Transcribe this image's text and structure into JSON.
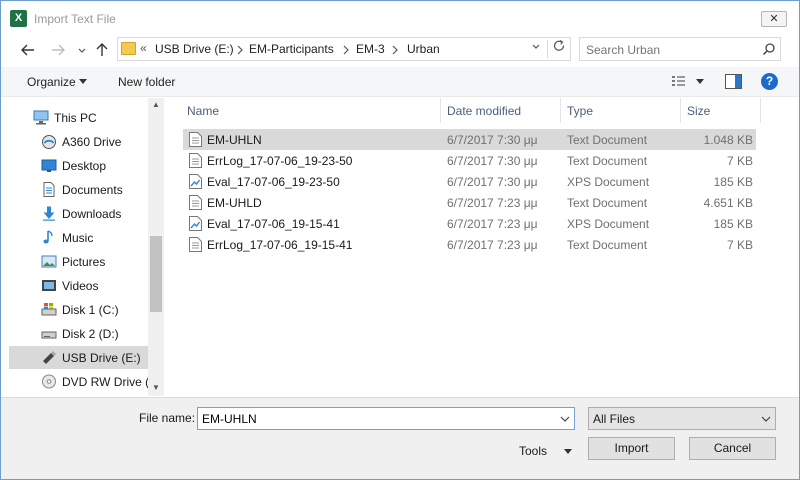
{
  "window": {
    "title": "Import Text File",
    "app_icon": "excel-icon",
    "app_icon_glyph": "X",
    "close_glyph": "✕"
  },
  "address_bar": {
    "overflow_glyph": "«",
    "path": [
      "USB Drive (E:)",
      "EM-Participants",
      "EM-3",
      "Urban"
    ]
  },
  "search": {
    "placeholder": "Search Urban"
  },
  "toolbar": {
    "organize_label": "Organize",
    "new_folder_label": "New folder",
    "help_glyph": "?"
  },
  "nav_pane": {
    "items": [
      {
        "label": "This PC",
        "icon": "computer-icon"
      },
      {
        "label": "A360 Drive",
        "icon": "cloud-drive-icon"
      },
      {
        "label": "Desktop",
        "icon": "desktop-icon"
      },
      {
        "label": "Documents",
        "icon": "documents-icon"
      },
      {
        "label": "Downloads",
        "icon": "downloads-icon"
      },
      {
        "label": "Music",
        "icon": "music-icon"
      },
      {
        "label": "Pictures",
        "icon": "pictures-icon"
      },
      {
        "label": "Videos",
        "icon": "videos-icon"
      },
      {
        "label": "Disk 1 (C:)",
        "icon": "windows-drive-icon"
      },
      {
        "label": "Disk 2 (D:)",
        "icon": "drive-icon"
      },
      {
        "label": "USB Drive (E:)",
        "icon": "usb-drive-icon",
        "selected": true
      },
      {
        "label": "DVD RW Drive (F",
        "icon": "dvd-drive-icon"
      }
    ]
  },
  "file_list": {
    "columns": [
      "Name",
      "Date modified",
      "Type",
      "Size"
    ],
    "rows": [
      {
        "name": "EM-UHLN",
        "date": "6/7/2017 7:30 μμ",
        "type": "Text Document",
        "size": "1.048 KB",
        "icon": "text-document-icon",
        "selected": true
      },
      {
        "name": "ErrLog_17-07-06_19-23-50",
        "date": "6/7/2017 7:30 μμ",
        "type": "Text Document",
        "size": "7 KB",
        "icon": "text-document-icon"
      },
      {
        "name": "Eval_17-07-06_19-23-50",
        "date": "6/7/2017 7:30 μμ",
        "type": "XPS Document",
        "size": "185 KB",
        "icon": "xps-document-icon"
      },
      {
        "name": "EM-UHLD",
        "date": "6/7/2017 7:23 μμ",
        "type": "Text Document",
        "size": "4.651 KB",
        "icon": "text-document-icon"
      },
      {
        "name": "Eval_17-07-06_19-15-41",
        "date": "6/7/2017 7:23 μμ",
        "type": "XPS Document",
        "size": "185 KB",
        "icon": "xps-document-icon"
      },
      {
        "name": "ErrLog_17-07-06_19-15-41",
        "date": "6/7/2017 7:23 μμ",
        "type": "Text Document",
        "size": "7 KB",
        "icon": "text-document-icon"
      }
    ]
  },
  "bottom": {
    "file_name_label": "File name:",
    "file_name_value": "EM-UHLN",
    "filter_value": "All Files",
    "tools_label": "Tools",
    "import_label": "Import",
    "cancel_label": "Cancel"
  },
  "colors": {
    "selection": "#d9d9d9",
    "help_blue": "#1a6cc8",
    "excel_green": "#1e7145",
    "header_text": "#4c607a"
  }
}
